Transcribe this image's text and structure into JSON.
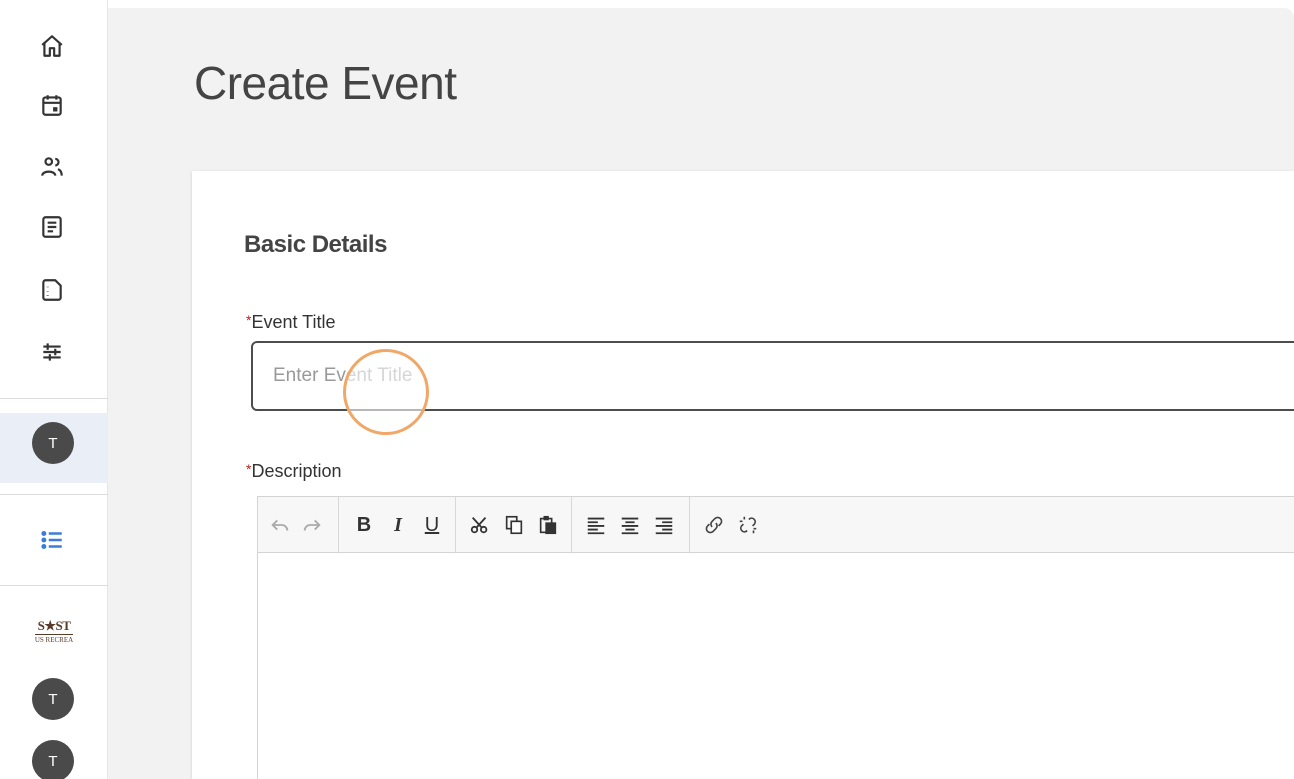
{
  "sidebar": {
    "nav": [
      {
        "icon": "home-icon"
      },
      {
        "icon": "calendar-icon"
      },
      {
        "icon": "people-icon"
      },
      {
        "icon": "document-icon"
      },
      {
        "icon": "file-icon"
      },
      {
        "icon": "sliders-icon"
      }
    ],
    "user_avatar": "T",
    "list_icon": "list-icon",
    "logo": {
      "top": "S★ST",
      "bottom": "US RECREA"
    },
    "avatars": [
      "T",
      "T"
    ]
  },
  "page": {
    "title": "Create Event"
  },
  "form": {
    "section_title": "Basic Details",
    "title_field": {
      "required_mark": "*",
      "label": "Event Title",
      "placeholder": "Enter Event Title",
      "value": ""
    },
    "description_field": {
      "required_mark": "*",
      "label": "Description"
    },
    "toolbar": {
      "bold": "B",
      "italic": "I",
      "underline": "U"
    }
  },
  "colors": {
    "accent": "#3b7dd8",
    "required": "#b22222",
    "cursor_ring": "#f0a868"
  }
}
